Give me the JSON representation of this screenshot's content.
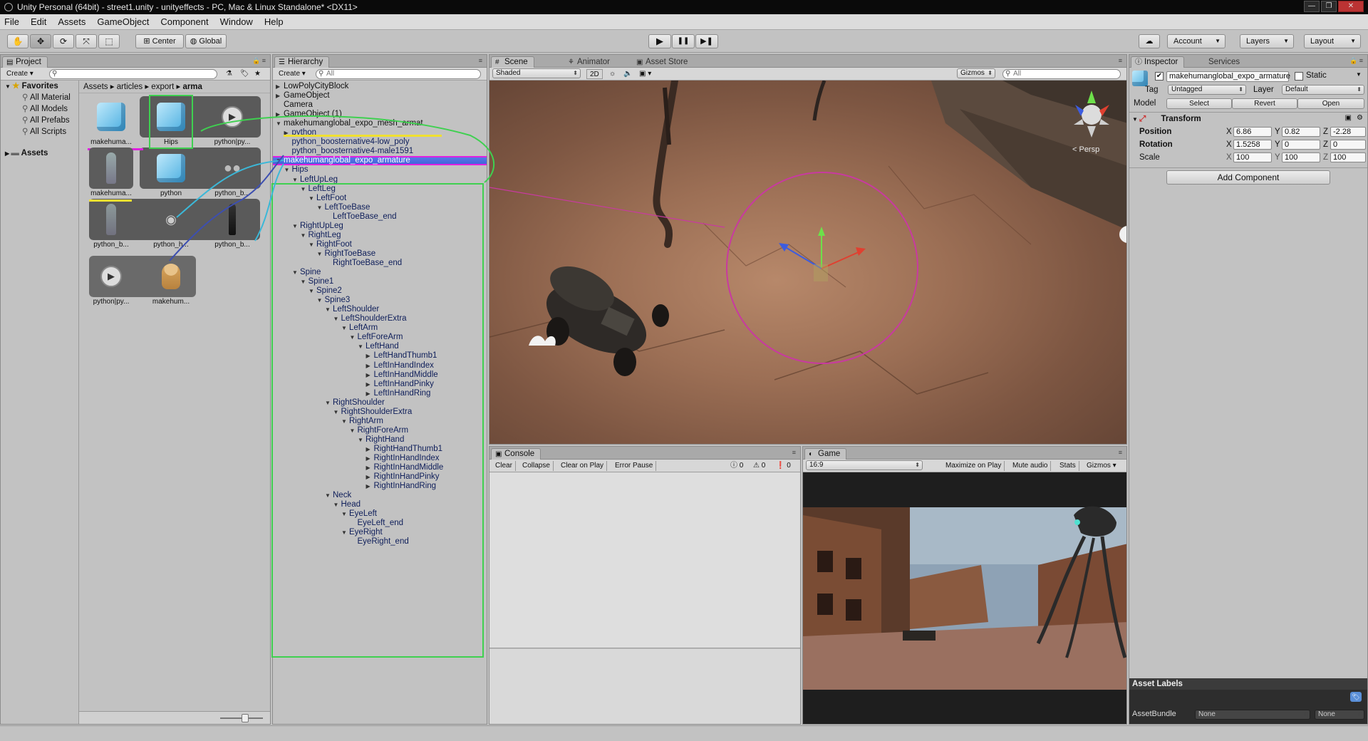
{
  "window": {
    "title": "Unity Personal (64bit) - street1.unity - unityeffects - PC, Mac & Linux Standalone* <DX11>",
    "controls": [
      "—",
      "❐",
      "✕"
    ]
  },
  "menu": [
    "File",
    "Edit",
    "Assets",
    "GameObject",
    "Component",
    "Window",
    "Help"
  ],
  "toolbar": {
    "tools": [
      "hand-tool",
      "move-tool",
      "rotate-tool",
      "scale-tool",
      "rect-tool"
    ],
    "pivot": "Center",
    "space": "Global",
    "play": "▶",
    "pause": "❚❚",
    "step": "▶❚",
    "cloud": "☁",
    "account": "Account",
    "layers": "Layers",
    "layout": "Layout"
  },
  "project": {
    "tab": "Project",
    "create": "Create",
    "favorites": {
      "label": "Favorites",
      "items": [
        "All Material",
        "All Models",
        "All Prefabs",
        "All Scripts"
      ]
    },
    "assets_label": "Assets",
    "breadcrumb": [
      "Assets",
      "articles",
      "export",
      "arma"
    ],
    "items": [
      {
        "label": "makehuma..."
      },
      {
        "label": "Hips"
      },
      {
        "label": "python|py..."
      },
      {
        "label": "makehuma..."
      },
      {
        "label": "python"
      },
      {
        "label": "python_b..."
      },
      {
        "label": "python_b..."
      },
      {
        "label": "python_h..."
      },
      {
        "label": "python_b..."
      },
      {
        "label": "python|py..."
      },
      {
        "label": "makehum..."
      }
    ]
  },
  "hierarchy": {
    "tab": "Hierarchy",
    "create": "Create",
    "search_placeholder": "All",
    "rows": [
      {
        "label": "LowPolyCityBlock",
        "arrow": "▶"
      },
      {
        "label": "GameObject",
        "arrow": "▶"
      },
      {
        "label": "Camera",
        "arrow": ""
      },
      {
        "label": "GameObject (1)",
        "arrow": "▶"
      },
      {
        "label": "makehumanglobal_expo_mesh_armat",
        "arrow": "▼"
      },
      {
        "label": "python",
        "arrow": "▶"
      },
      {
        "label": "python_boosternative4-low_poly",
        "arrow": ""
      },
      {
        "label": "python_boosternative4-male1591",
        "arrow": ""
      },
      {
        "label": "makehumanglobal_expo_armature",
        "arrow": "▼"
      },
      {
        "label": "Hips",
        "arrow": "▼"
      },
      {
        "label": "LeftUpLeg",
        "arrow": "▼"
      },
      {
        "label": "LeftLeg",
        "arrow": "▼"
      },
      {
        "label": "LeftFoot",
        "arrow": "▼"
      },
      {
        "label": "LeftToeBase",
        "arrow": "▼"
      },
      {
        "label": "LeftToeBase_end",
        "arrow": ""
      },
      {
        "label": "RightUpLeg",
        "arrow": "▼"
      },
      {
        "label": "RightLeg",
        "arrow": "▼"
      },
      {
        "label": "RightFoot",
        "arrow": "▼"
      },
      {
        "label": "RightToeBase",
        "arrow": "▼"
      },
      {
        "label": "RightToeBase_end",
        "arrow": ""
      },
      {
        "label": "Spine",
        "arrow": "▼"
      },
      {
        "label": "Spine1",
        "arrow": "▼"
      },
      {
        "label": "Spine2",
        "arrow": "▼"
      },
      {
        "label": "Spine3",
        "arrow": "▼"
      },
      {
        "label": "LeftShoulder",
        "arrow": "▼"
      },
      {
        "label": "LeftShoulderExtra",
        "arrow": "▼"
      },
      {
        "label": "LeftArm",
        "arrow": "▼"
      },
      {
        "label": "LeftForeArm",
        "arrow": "▼"
      },
      {
        "label": "LeftHand",
        "arrow": "▼"
      },
      {
        "label": "LeftHandThumb1",
        "arrow": "▶"
      },
      {
        "label": "LeftInHandIndex",
        "arrow": "▶"
      },
      {
        "label": "LeftInHandMiddle",
        "arrow": "▶"
      },
      {
        "label": "LeftInHandPinky",
        "arrow": "▶"
      },
      {
        "label": "LeftInHandRing",
        "arrow": "▶"
      },
      {
        "label": "RightShoulder",
        "arrow": "▼"
      },
      {
        "label": "RightShoulderExtra",
        "arrow": "▼"
      },
      {
        "label": "RightArm",
        "arrow": "▼"
      },
      {
        "label": "RightForeArm",
        "arrow": "▼"
      },
      {
        "label": "RightHand",
        "arrow": "▼"
      },
      {
        "label": "RightHandThumb1",
        "arrow": "▶"
      },
      {
        "label": "RightInHandIndex",
        "arrow": "▶"
      },
      {
        "label": "RightInHandMiddle",
        "arrow": "▶"
      },
      {
        "label": "RightInHandPinky",
        "arrow": "▶"
      },
      {
        "label": "RightInHandRing",
        "arrow": "▶"
      },
      {
        "label": "Neck",
        "arrow": "▼"
      },
      {
        "label": "Head",
        "arrow": "▼"
      },
      {
        "label": "EyeLeft",
        "arrow": "▼"
      },
      {
        "label": "EyeLeft_end",
        "arrow": ""
      },
      {
        "label": "EyeRight",
        "arrow": "▼"
      },
      {
        "label": "EyeRight_end",
        "arrow": ""
      }
    ]
  },
  "scene": {
    "tabs": [
      "Scene",
      "Animator",
      "Asset Store"
    ],
    "shading": "Shaded",
    "mode_2d": "2D",
    "gizmos": "Gizmos",
    "search_placeholder": "All",
    "persp": "< Persp"
  },
  "console": {
    "tab": "Console",
    "buttons": [
      "Clear",
      "Collapse",
      "Clear on Play",
      "Error Pause"
    ],
    "counts": [
      "0",
      "0",
      "0"
    ]
  },
  "game": {
    "tab": "Game",
    "aspect": "16:9",
    "buttons": [
      "Maximize on Play",
      "Mute audio",
      "Stats",
      "Gizmos"
    ]
  },
  "inspector": {
    "tabs": [
      "Inspector",
      "Services"
    ],
    "object_name": "makehumanglobal_expo_armature",
    "static_label": "Static",
    "tag_label": "Tag",
    "tag_value": "Untagged",
    "layer_label": "Layer",
    "layer_value": "Default",
    "model_label": "Model",
    "model_buttons": [
      "Select",
      "Revert",
      "Open"
    ],
    "transform_label": "Transform",
    "position": {
      "label": "Position",
      "x": "6.86",
      "y": "0.82",
      "z": "-2.28"
    },
    "rotation": {
      "label": "Rotation",
      "x": "1.5258",
      "y": "0",
      "z": "0"
    },
    "scale": {
      "label": "Scale",
      "x": "100",
      "y": "100",
      "z": "100"
    },
    "axis": [
      "X",
      "Y",
      "Z"
    ],
    "add_component": "Add Component",
    "asset_labels": "Asset Labels",
    "asset_bundle_label": "AssetBundle",
    "asset_bundle_value": "None",
    "asset_bundle_variant": "None"
  }
}
